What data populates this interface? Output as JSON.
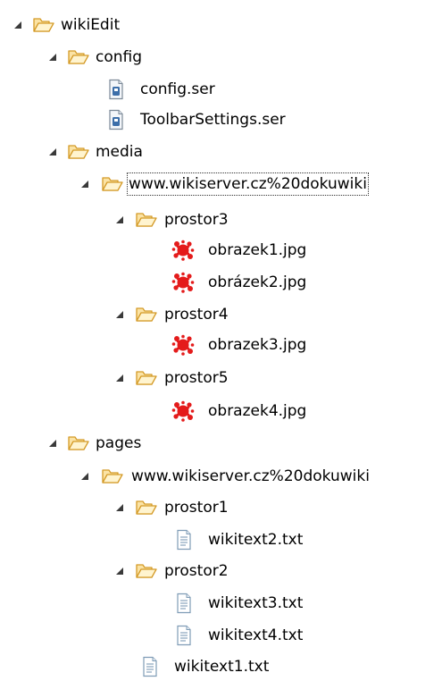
{
  "tree": {
    "root": "wikiEdit",
    "config": {
      "label": "config",
      "files": [
        "config.ser",
        "ToolbarSettings.ser"
      ]
    },
    "media": {
      "label": "media",
      "site": "www.wikiserver.cz%20dokuwiki",
      "prostor3": {
        "label": "prostor3",
        "files": [
          "obrazek1.jpg",
          "obrázek2.jpg"
        ]
      },
      "prostor4": {
        "label": "prostor4",
        "files": [
          "obrazek3.jpg"
        ]
      },
      "prostor5": {
        "label": "prostor5",
        "files": [
          "obrazek4.jpg"
        ]
      }
    },
    "pages": {
      "label": "pages",
      "site": "www.wikiserver.cz%20dokuwiki",
      "prostor1": {
        "label": "prostor1",
        "files": [
          "wikitext2.txt"
        ]
      },
      "prostor2": {
        "label": "prostor2",
        "files": [
          "wikitext3.txt",
          "wikitext4.txt"
        ]
      },
      "site_files": [
        "wikitext1.txt"
      ]
    }
  },
  "colors": {
    "folder_fill": "#fbe3a4",
    "folder_stroke": "#d49a27",
    "image_icon": "#e41b1b",
    "text_icon": "#7f9cb6",
    "ser_icon": "#3c6ea9"
  },
  "icons": {
    "folder": "folder-open-icon",
    "ser": "ser-file-icon",
    "image": "image-file-icon",
    "text": "text-file-icon",
    "twisty": "expanded-triangle-icon"
  }
}
